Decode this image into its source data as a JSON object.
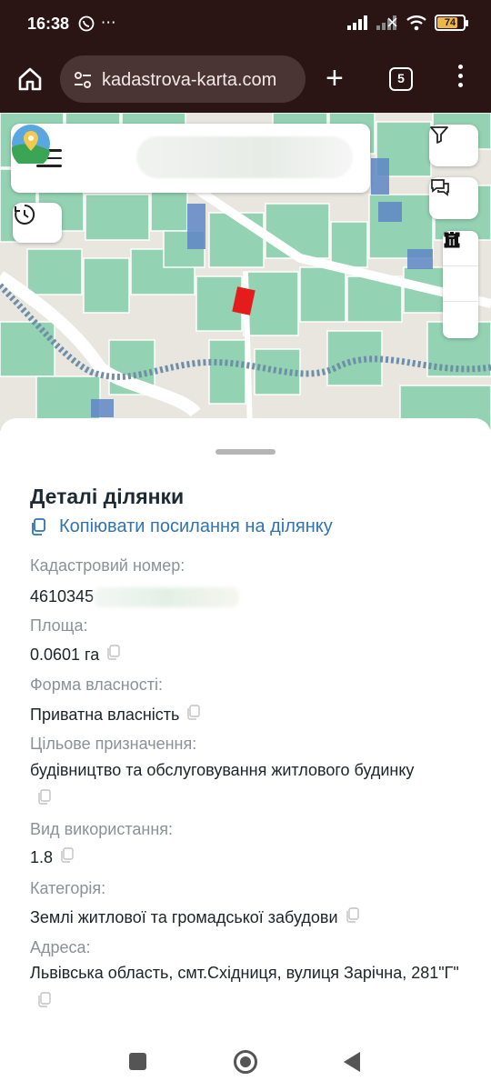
{
  "status_bar": {
    "time": "16:38",
    "left_icons": [
      "viber-icon",
      "more-dots-icon"
    ],
    "right_icons": [
      "signal-icon",
      "signal-2-icon",
      "wifi-icon",
      "battery-icon"
    ],
    "battery_level": "74"
  },
  "browser": {
    "url": "kadastrova-karta.com",
    "tab_count": "5"
  },
  "map": {
    "buttons": [
      "menu-icon",
      "filter-icon",
      "chat-icon",
      "history-icon",
      "line-tool-icon",
      "polygon-tool-icon",
      "trash-icon"
    ]
  },
  "sheet": {
    "title": "Деталі ділянки",
    "copy_link": "Копіювати посилання на ділянку",
    "fields": {
      "cadastral": {
        "label": "Кадастровий номер:",
        "value": "4610345"
      },
      "area": {
        "label": "Площа:",
        "value": "0.0601 га"
      },
      "ownership": {
        "label": "Форма власності:",
        "value": "Приватна власність"
      },
      "purpose": {
        "label": "Цільове призначення:",
        "value": "будівництво та обслуговування житлового будинку"
      },
      "usage": {
        "label": "Вид використання:",
        "value": "1.8"
      },
      "category": {
        "label": "Категорія:",
        "value": "Землі житлової та громадської забудови"
      },
      "address": {
        "label": "Адреса:",
        "value": "Львівська область, смт.Східниця, вулиця Зарічна, 281\"Г\""
      }
    }
  },
  "colors": {
    "chrome_bg": "#2a1414",
    "parcel_green": "#8fd1b0",
    "selected_parcel": "#e51c1c",
    "link_blue": "#2f73b5",
    "river": "#6f8fa8"
  }
}
